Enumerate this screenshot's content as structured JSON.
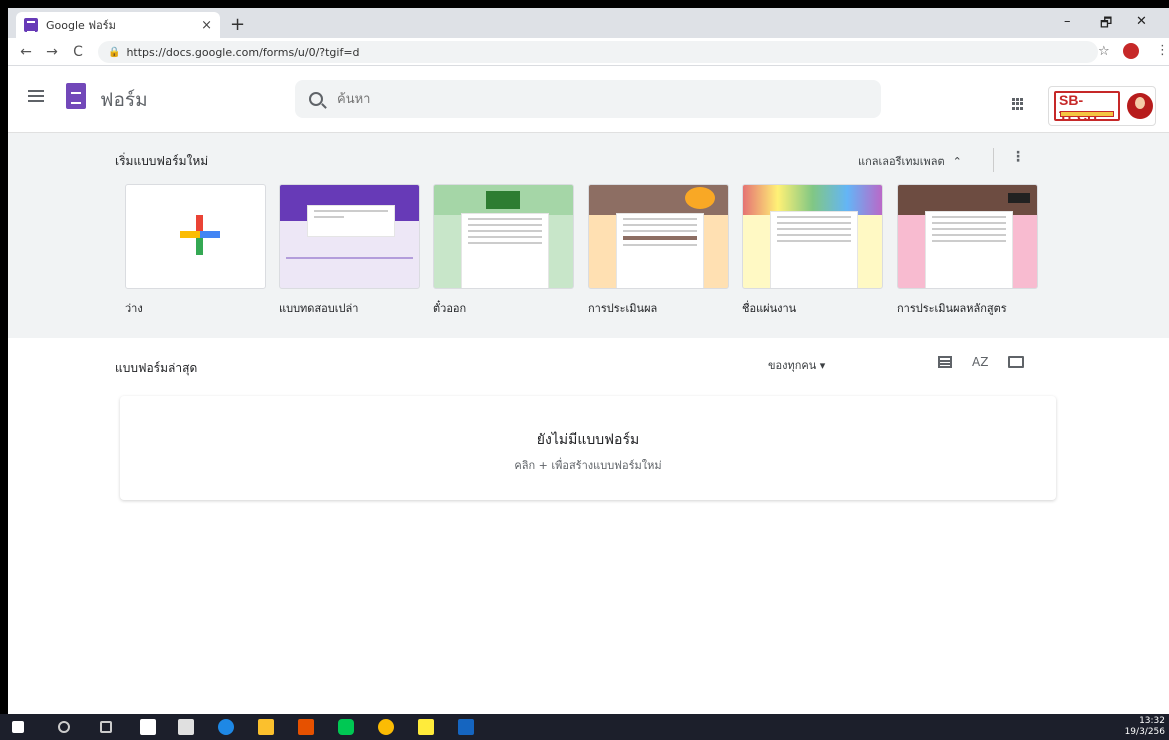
{
  "browser": {
    "tab_title": "Google ฟอร์ม",
    "tab_close": "×",
    "new_tab": "+",
    "url": "https://docs.google.com/forms/u/0/?tgif=d",
    "back": "←",
    "forward": "→",
    "reload": "C",
    "star": "☆",
    "menu": "⋮",
    "window_min": "–",
    "window_max": "🗗",
    "window_close": "✕"
  },
  "header": {
    "app_name": "ฟอร์ม",
    "search_placeholder": "ค้นหา",
    "account_logo_text": "SB-TECH"
  },
  "templates": {
    "section_title": "เริ่มแบบฟอร์มใหม่",
    "gallery_label": "แกลเลอรีเทมเพลต",
    "gallery_chevron": "⌃",
    "more": "⋮",
    "items": [
      {
        "label": "ว่าง",
        "bg": "#ffffff"
      },
      {
        "label": "แบบทดสอบเปล่า",
        "bg": "#ede7f6"
      },
      {
        "label": "ตั๋วออก",
        "bg": "#c8e6c9"
      },
      {
        "label": "การประเมินผล",
        "bg": "#ffe0b2"
      },
      {
        "label": "ชื่อแผ่นงาน",
        "bg": "#fff9c4"
      },
      {
        "label": "การประเมินผลหลักสูตร",
        "bg": "#f8bbd0"
      }
    ]
  },
  "recent": {
    "title": "แบบฟอร์มล่าสุด",
    "owner_filter": "ของทุกคน ▾",
    "sort_icon": "AZ",
    "empty_title": "ยังไม่มีแบบฟอร์ม",
    "empty_subtitle": "คลิก + เพื่อสร้างแบบฟอร์มใหม่"
  },
  "taskbar": {
    "time": "13:32",
    "date": "19/3/256"
  },
  "colors": {
    "forms_purple": "#7248b9",
    "template_bg": "#f1f3f4"
  }
}
